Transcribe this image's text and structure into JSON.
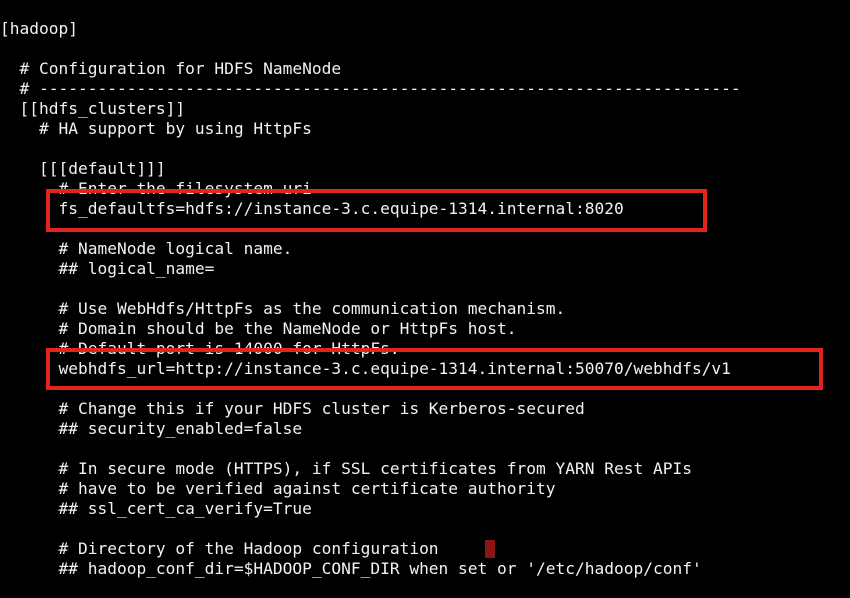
{
  "terminal": {
    "lines": [
      "[hadoop]",
      "",
      "  # Configuration for HDFS NameNode",
      "  # ------------------------------------------------------------------------",
      "  [[hdfs_clusters]]",
      "    # HA support by using HttpFs",
      "",
      "    [[[default]]]",
      "      # Enter the filesystem uri",
      "      fs_defaultfs=hdfs://instance-3.c.equipe-1314.internal:8020",
      "",
      "      # NameNode logical name.",
      "      ## logical_name=",
      "",
      "      # Use WebHdfs/HttpFs as the communication mechanism.",
      "      # Domain should be the NameNode or HttpFs host.",
      "      # Default port is 14000 for HttpFs.",
      "      webhdfs_url=http://instance-3.c.equipe-1314.internal:50070/webhdfs/v1",
      "",
      "      # Change this if your HDFS cluster is Kerberos-secured",
      "      ## security_enabled=false",
      "",
      "      # In secure mode (HTTPS), if SSL certificates from YARN Rest APIs",
      "      # have to be verified against certificate authority",
      "      ## ssl_cert_ca_verify=True",
      "",
      "      # Directory of the Hadoop configuration",
      "      ## hadoop_conf_dir=$HADOOP_CONF_DIR when set or '/etc/hadoop/conf'"
    ]
  },
  "colors": {
    "background": "#000000",
    "text": "#f2f2f2",
    "highlight": "#e3231e",
    "cursor": "#8b1616"
  }
}
